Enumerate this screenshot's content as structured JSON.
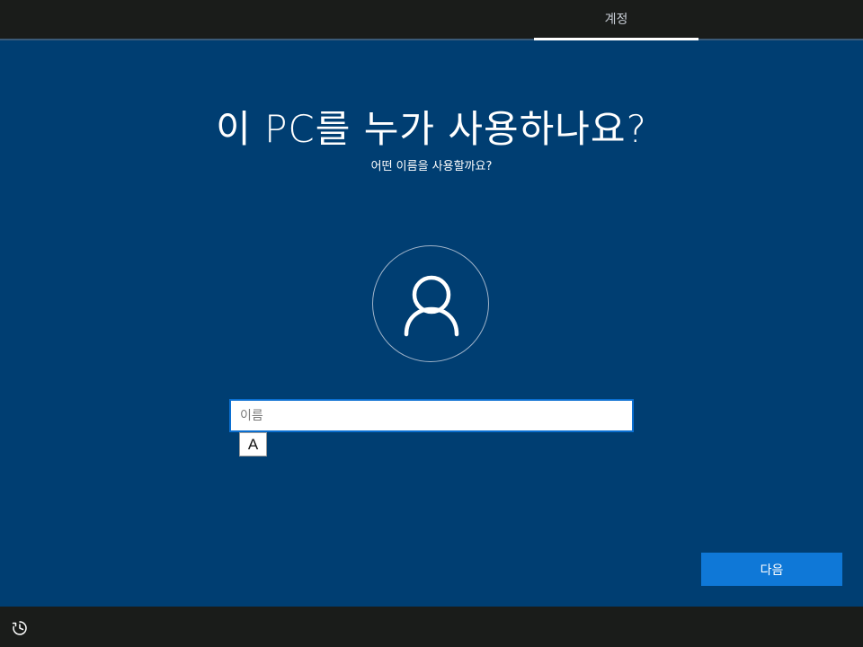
{
  "header": {
    "step_label": "계정"
  },
  "main": {
    "title": "이 PC를 누가 사용하나요?",
    "subtitle": "어떤 이름을 사용할까요?",
    "avatar_icon": "user-icon",
    "name_input": {
      "placeholder": "이름",
      "value": ""
    },
    "ime_mode": "A"
  },
  "footer": {
    "next_label": "다음",
    "accessibility_icon": "ease-of-access-icon"
  },
  "colors": {
    "background": "#003e72",
    "bar": "#1a1c1a",
    "accent": "#0f78d7"
  }
}
